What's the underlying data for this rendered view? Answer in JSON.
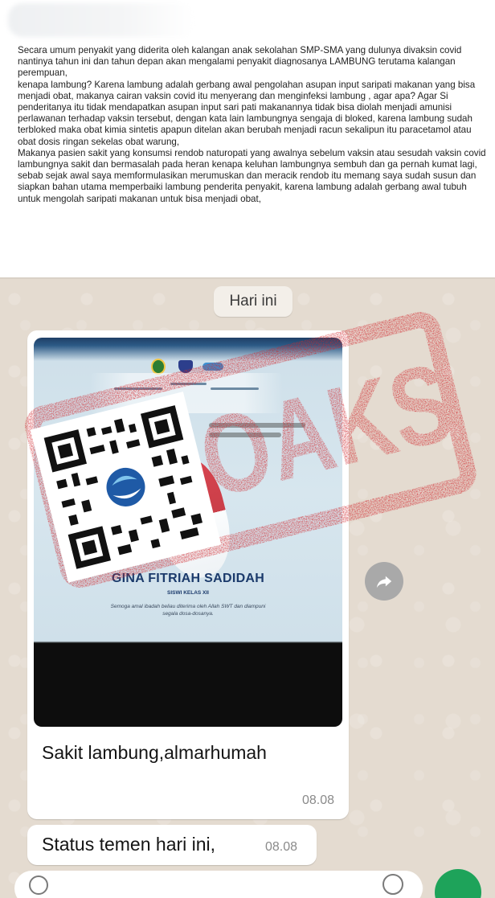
{
  "top_message": {
    "paragraphs": [
      "Secara umum penyakit yang diderita oleh kalangan anak sekolahan SMP-SMA yang dulunya divaksin covid nantinya tahun ini dan tahun depan akan mengalami penyakit diagnosanya LAMBUNG terutama kalangan perempuan,",
      "kenapa lambung? Karena lambung adalah gerbang awal pengolahan asupan input saripati makanan yang bisa menjadi obat, makanya cairan vaksin covid itu menyerang dan menginfeksi lambung , agar apa? Agar Si penderitanya itu tidak mendapatkan asupan input sari pati makanannya tidak bisa diolah menjadi amunisi perlawanan terhadap vaksin tersebut, dengan kata lain lambungnya sengaja di bloked, karena  lambung sudah terbloked maka obat kimia sintetis apapun ditelan akan berubah menjadi racun sekalipun itu paracetamol atau obat dosis ringan sekelas obat warung,",
      "Makanya pasien sakit yang konsumsi rendob naturopati yang awalnya sebelum vaksin atau sesudah vaksin covid lambungnya sakit dan bermasalah pada heran kenapa keluhan lambungnya sembuh dan ga pernah kumat lagi, sebab sejak awal saya memformulasikan merumuskan dan meracik rendob itu memang saya sudah susun dan siapkan bahan utama memperbaiki lambung penderita penyakit, karena lambung adalah gerbang awal tubuh untuk mengolah saripati makanan untuk bisa menjadi obat,"
    ]
  },
  "chat": {
    "day_label": "Hari ini",
    "image_message": {
      "poster_name": "GINA FITRIAH SADIDAH",
      "poster_sub": "SISWI KELAS XII",
      "poster_prayer": "Semoga amal ibadah beliau diterima oleh Allah SWT dan diampuni segala dosa-dosanya.",
      "caption": "Sakit lambung,almarhumah",
      "time": "08.08"
    },
    "status_message": {
      "text": "Status temen hari ini,",
      "time": "08.08"
    }
  },
  "stamp": {
    "text": "HOAKS",
    "color": "#d0252b"
  },
  "icons": {
    "forward": "forward-icon",
    "emoji": "emoji-icon",
    "attach": "attach-icon",
    "camera": "camera-icon",
    "mic": "mic-icon"
  },
  "colors": {
    "chat_background": "#e4dbd0",
    "send_button": "#1ea35a"
  }
}
